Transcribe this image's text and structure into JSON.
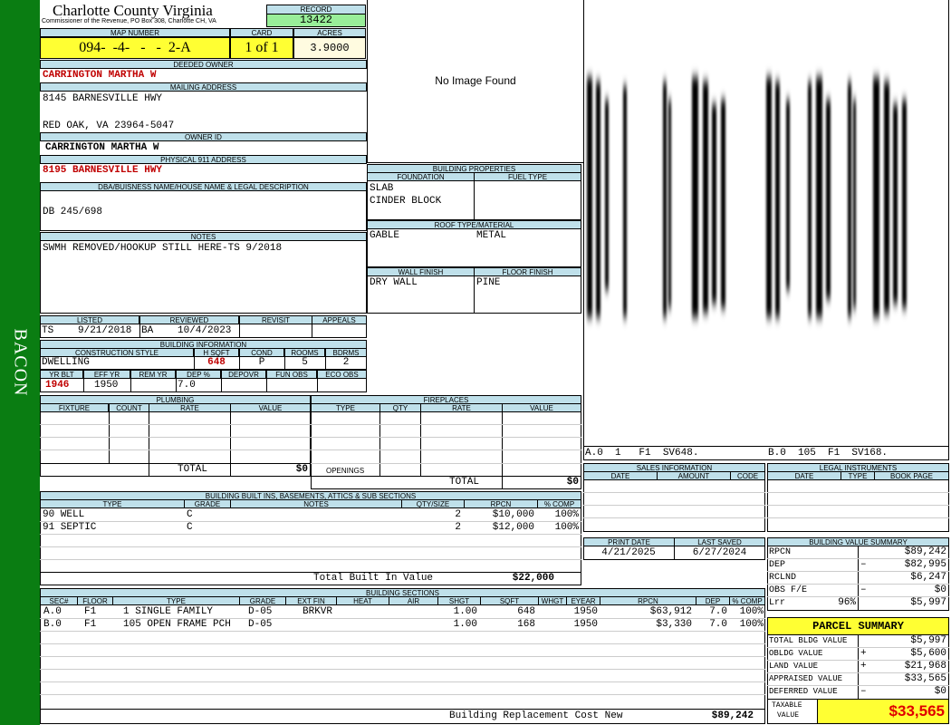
{
  "sidebar": {
    "label": "BACON",
    "color": "#0a7d12"
  },
  "header": {
    "county": "Charlotte County Virginia",
    "commissioner": "Commissioner of the Revenue, PO Box 308, Charlotte CH, VA",
    "record_label": "RECORD",
    "record": "13422",
    "map_label": "MAP NUMBER",
    "map_number": "094-  -4-   -   -  2-A",
    "card_label": "CARD",
    "card": "1 of 1",
    "acres_label": "ACRES",
    "acres": "3.9000"
  },
  "owner": {
    "deeded_label": "DEEDED OWNER",
    "deeded": "CARRINGTON MARTHA W",
    "mailing_label": "MAILING ADDRESS",
    "mailing1": "8145 BARNESVILLE HWY",
    "mailing2": "RED OAK, VA 23964-5047",
    "owner_id_label": "OWNER ID",
    "owner_id": "CARRINGTON MARTHA W",
    "physical_label": "PHYSICAL 911 ADDRESS",
    "physical": "8195 BARNESVILLE HWY",
    "dba_label": "DBA/BUISNESS NAME/HOUSE NAME & LEGAL DESCRIPTION",
    "dba": "DB 245/698",
    "notes_label": "NOTES",
    "notes": "SWMH REMOVED/HOOKUP STILL HERE-TS 9/2018"
  },
  "image": {
    "none": "No Image Found"
  },
  "sketch": {
    "caption1": "A.0  1   F1  SV648.",
    "caption2": "B.0  105  F1  SV168."
  },
  "props": {
    "title": "BUILDING PROPERTIES",
    "foundation_label": "FOUNDATION",
    "fuel_label": "FUEL TYPE",
    "foundation1": "SLAB",
    "foundation2": "CINDER BLOCK",
    "roof_label": "ROOF TYPE/MATERIAL",
    "roof_type": "GABLE",
    "roof_material": "METAL",
    "wall_label": "WALL FINISH",
    "floor_label": "FLOOR FINISH",
    "wall": "DRY WALL",
    "floor": "PINE"
  },
  "review": {
    "listed_label": "LISTED",
    "reviewed_label": "REVIEWED",
    "revisit_label": "REVISIT",
    "appeals_label": "APPEALS",
    "listed_by": "TS",
    "listed_date": "9/21/2018",
    "reviewed_by": "BA",
    "reviewed_date": "10/4/2023"
  },
  "bldg": {
    "title": "BUILDING INFORMATION",
    "style_label": "CONSTRUCTION STYLE",
    "hsqft_label": "H SQFT",
    "cond_label": "COND",
    "rooms_label": "ROOMS",
    "bdrms_label": "BDRMS",
    "style": "DWELLING",
    "hsqft": "648",
    "cond": "P",
    "rooms": "5",
    "bdrms": "2",
    "yrblt_label": "YR BLT",
    "effyr_label": "EFF YR",
    "remyr_label": "REM YR",
    "dep_label": "DEP %",
    "depovr_label": "DEPOVR",
    "funobs_label": "FUN OBS",
    "ecoobs_label": "ECO OBS",
    "yrblt": "1946",
    "effyr": "1950",
    "dep": "7.0"
  },
  "plumbing": {
    "title": "PLUMBING",
    "cols": [
      "FIXTURE",
      "COUNT",
      "RATE",
      "VALUE"
    ],
    "total_label": "TOTAL",
    "total": "$0"
  },
  "fireplaces": {
    "title": "FIREPLACES",
    "cols": [
      "TYPE",
      "QTY",
      "RATE",
      "VALUE"
    ],
    "openings_label": "OPENINGS",
    "total_label": "TOTAL",
    "total": "$0"
  },
  "builtins": {
    "title": "BUILDING BUILT INS, BASEMENTS, ATTICS & SUB SECTIONS",
    "cols": [
      "TYPE",
      "GRADE",
      "NOTES",
      "QTY/SIZE",
      "RPCN",
      "% COMP"
    ],
    "rows": [
      {
        "type": "90 WELL",
        "grade": "C",
        "qty": "2",
        "rpcn": "$10,000",
        "comp": "100%"
      },
      {
        "type": "91 SEPTIC",
        "grade": "C",
        "qty": "2",
        "rpcn": "$12,000",
        "comp": "100%"
      }
    ],
    "total_label": "Total Built In Value",
    "total": "$22,000"
  },
  "sales": {
    "title": "SALES INFORMATION",
    "cols": [
      "DATE",
      "AMOUNT",
      "CODE"
    ]
  },
  "legal": {
    "title": "LEGAL INSTRUMENTS",
    "cols": [
      "DATE",
      "TYPE",
      "BOOK PAGE"
    ]
  },
  "print": {
    "print_label": "PRINT DATE",
    "saved_label": "LAST SAVED",
    "print_date": "4/21/2025",
    "saved_date": "6/27/2024"
  },
  "value_summary": {
    "title": "BUILDING VALUE SUMMARY",
    "rows": [
      {
        "label": "RPCN",
        "sign": "",
        "pct": "",
        "value": "$89,242"
      },
      {
        "label": "DEP",
        "sign": "–",
        "pct": "",
        "value": "$82,995"
      },
      {
        "label": "RCLND",
        "sign": "",
        "pct": "",
        "value": "$6,247"
      },
      {
        "label": "OBS F/E",
        "sign": "–",
        "pct": "",
        "value": "$0"
      },
      {
        "label": "Lrr",
        "sign": "",
        "pct": "96%",
        "value": "$5,997"
      }
    ]
  },
  "sections": {
    "title": "BUILDING SECTIONS",
    "cols": [
      "SEC#",
      "FLOOR",
      "TYPE",
      "GRADE",
      "EXT FIN",
      "HEAT",
      "AIR",
      "SHGT",
      "SQFT",
      "WHGT",
      "EYEAR",
      "RPCN",
      "DEP",
      "% COMP"
    ],
    "rows": [
      {
        "sec": "A.0",
        "floor": "F1",
        "type": "1 SINGLE FAMILY",
        "grade": "D-05",
        "ext": "BRKVR",
        "shgt": "1.00",
        "sqft": "648",
        "eyear": "1950",
        "rpcn": "$63,912",
        "dep": "7.0",
        "comp": "100%"
      },
      {
        "sec": "B.0",
        "floor": "F1",
        "type": "105 OPEN FRAME PCH",
        "grade": "D-05",
        "ext": "",
        "shgt": "1.00",
        "sqft": "168",
        "eyear": "1950",
        "rpcn": "$3,330",
        "dep": "7.0",
        "comp": "100%"
      }
    ],
    "total_label": "Building Replacement Cost New",
    "total": "$89,242"
  },
  "parcel": {
    "title": "PARCEL SUMMARY",
    "rows": [
      {
        "label": "TOTAL BLDG VALUE",
        "sign": "",
        "value": "$5,997"
      },
      {
        "label": "OBLDG VALUE",
        "sign": "+",
        "value": "$5,600"
      },
      {
        "label": "LAND VALUE",
        "sign": "+",
        "value": "$21,968"
      },
      {
        "label": "APPRAISED VALUE",
        "sign": "",
        "value": "$33,565"
      },
      {
        "label": "DEFERRED VALUE",
        "sign": "–",
        "value": "$0"
      }
    ],
    "taxable_label1": "TAXABLE",
    "taxable_label2": "VALUE",
    "taxable": "$33,565"
  }
}
